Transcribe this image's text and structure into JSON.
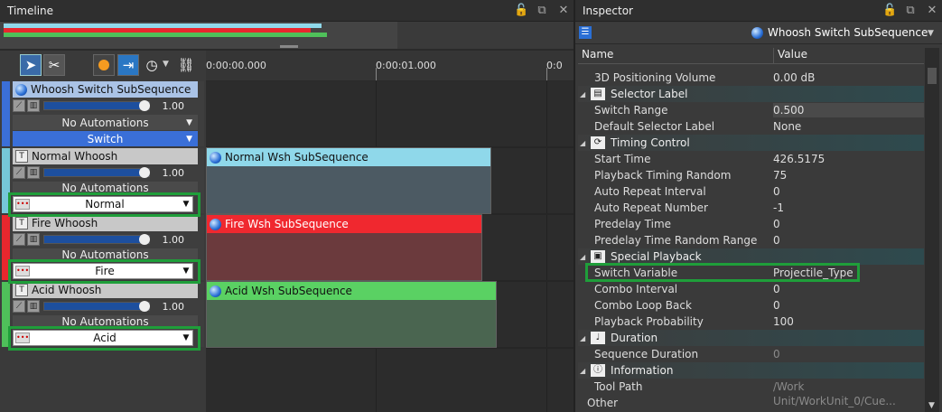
{
  "timeline": {
    "title": "Timeline",
    "ruler": [
      "0:00:00.000",
      "0:00:01.000",
      "0:0"
    ],
    "tracks": [
      {
        "name": "Whoosh Switch SubSequence",
        "volume": "1.00",
        "automations": "No Automations",
        "mode": "Switch",
        "color": "#3b6fd8"
      },
      {
        "name": "Normal Whoosh",
        "volume": "1.00",
        "automations": "No Automations",
        "switch_value": "Normal",
        "color": "#76c7d8"
      },
      {
        "name": "Fire Whoosh",
        "volume": "1.00",
        "automations": "No Automations",
        "switch_value": "Fire",
        "color": "#e8272e"
      },
      {
        "name": "Acid Whoosh",
        "volume": "1.00",
        "automations": "No Automations",
        "switch_value": "Acid",
        "color": "#4fc05a"
      }
    ],
    "clips": [
      {
        "label": "Normal Wsh SubSequence",
        "head_color": "#8fd8ea",
        "body_color": "#4c5a63"
      },
      {
        "label": "Fire Wsh SubSequence",
        "head_color": "#f0282f",
        "body_color": "#6b3a3d"
      },
      {
        "label": "Acid Wsh SubSequence",
        "head_color": "#5ad163",
        "body_color": "#4a6550"
      }
    ]
  },
  "inspector": {
    "title": "Inspector",
    "object_name": "Whoosh Switch SubSequence",
    "col_name": "Name",
    "col_value": "Value",
    "rows": [
      {
        "type": "prop",
        "name": "3D Positioning Volume",
        "value": "0.00 dB"
      },
      {
        "type": "cat",
        "name": "Selector Label",
        "icon": "selector-icon"
      },
      {
        "type": "prop",
        "name": "Switch Range",
        "value": "0.500"
      },
      {
        "type": "prop",
        "name": "Default Selector Label",
        "value": "None"
      },
      {
        "type": "cat",
        "name": "Timing Control",
        "icon": "timing-icon"
      },
      {
        "type": "prop",
        "name": "Start Time",
        "value": "426.5175"
      },
      {
        "type": "prop",
        "name": "Playback Timing Random",
        "value": "75"
      },
      {
        "type": "prop",
        "name": "Auto Repeat Interval",
        "value": "0"
      },
      {
        "type": "prop",
        "name": "Auto Repeat Number",
        "value": "-1"
      },
      {
        "type": "prop",
        "name": "Predelay Time",
        "value": "0"
      },
      {
        "type": "prop",
        "name": "Predelay Time Random Range",
        "value": "0"
      },
      {
        "type": "cat",
        "name": "Special Playback",
        "icon": "camera-icon"
      },
      {
        "type": "prop",
        "name": "Switch Variable",
        "value": "Projectile_Type"
      },
      {
        "type": "prop",
        "name": "Combo Interval",
        "value": "0"
      },
      {
        "type": "prop",
        "name": "Combo Loop Back",
        "value": "0"
      },
      {
        "type": "prop",
        "name": "Playback Probability",
        "value": "100"
      },
      {
        "type": "cat",
        "name": "Duration",
        "icon": "note-icon"
      },
      {
        "type": "prop",
        "name": "Sequence Duration",
        "value": "0"
      },
      {
        "type": "cat",
        "name": "Information",
        "icon": "info-icon"
      },
      {
        "type": "prop",
        "name": "Tool Path",
        "value": "/Work Unit/WorkUnit_0/Cue..."
      },
      {
        "type": "plain",
        "name": "Other",
        "value": ""
      }
    ]
  },
  "colors": {
    "accent_green": "#1f9e3a"
  }
}
